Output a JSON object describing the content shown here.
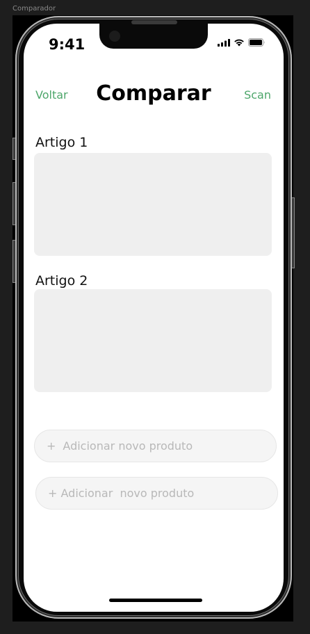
{
  "frame": {
    "label": "Comparador"
  },
  "status_bar": {
    "time": "9:41",
    "icons": [
      "cellular-signal-icon",
      "wifi-icon",
      "battery-icon"
    ]
  },
  "nav": {
    "back_label": "Voltar",
    "title": "Comparar",
    "scan_label": "Scan",
    "accent_color": "#4da66a"
  },
  "articles": [
    {
      "label": "Artigo 1"
    },
    {
      "label": "Artigo 2"
    }
  ],
  "add_buttons": [
    {
      "plus": "+",
      "label": "Adicionar novo produto"
    },
    {
      "label": "+ Adicionar  novo produto"
    }
  ]
}
